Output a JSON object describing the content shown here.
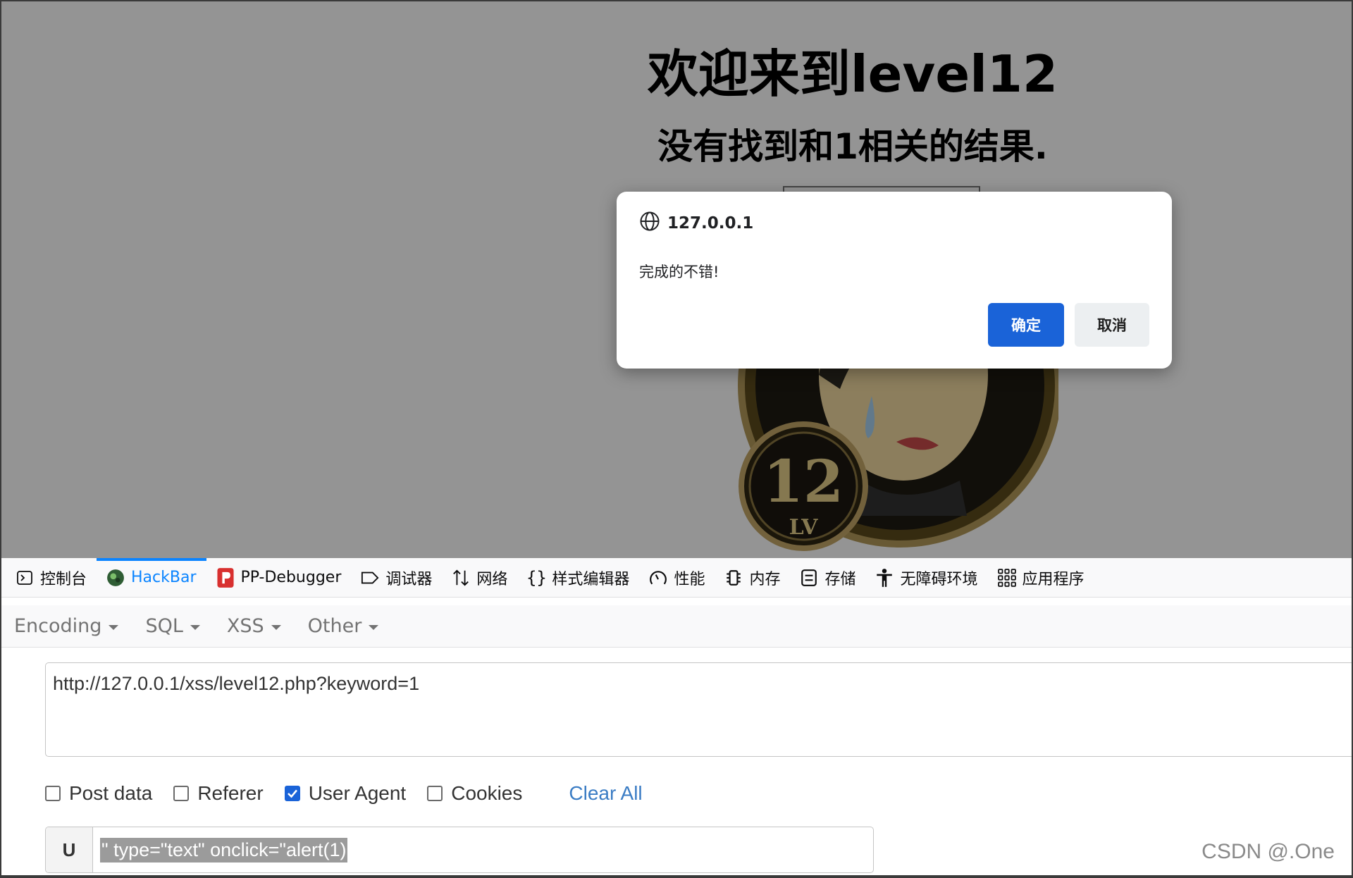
{
  "page": {
    "title": "欢迎来到level12",
    "message": "没有找到和1相关的结果.",
    "badge_number": "12",
    "badge_text": "LV"
  },
  "dialog": {
    "origin": "127.0.0.1",
    "message": "完成的不错!",
    "ok_label": "确定",
    "cancel_label": "取消",
    "ok_color": "#1a63d8"
  },
  "devtools": {
    "tabs": [
      {
        "label": "控制台",
        "icon": "console-icon"
      },
      {
        "label": "HackBar",
        "icon": "hackbar-icon",
        "active": true
      },
      {
        "label": "PP-Debugger",
        "icon": "pp-debugger-icon"
      },
      {
        "label": "调试器",
        "icon": "debugger-icon"
      },
      {
        "label": "网络",
        "icon": "network-icon"
      },
      {
        "label": "样式编辑器",
        "icon": "style-editor-icon"
      },
      {
        "label": "性能",
        "icon": "performance-icon"
      },
      {
        "label": "内存",
        "icon": "memory-icon"
      },
      {
        "label": "存储",
        "icon": "storage-icon"
      },
      {
        "label": "无障碍环境",
        "icon": "accessibility-icon"
      },
      {
        "label": "应用程序",
        "icon": "application-icon"
      }
    ],
    "active_color": "#0a84ff"
  },
  "hackbar": {
    "menus": [
      "Encoding",
      "SQL",
      "XSS",
      "Other"
    ],
    "url": "http://127.0.0.1/xss/level12.php?keyword=1",
    "options": [
      {
        "label": "Post data",
        "checked": false
      },
      {
        "label": "Referer",
        "checked": false
      },
      {
        "label": "User Agent",
        "checked": true
      },
      {
        "label": "Cookies",
        "checked": false
      }
    ],
    "clear_all": "Clear All",
    "ua_label": "U",
    "ua_value": "\" type=\"text\" onclick=\"alert(1)"
  },
  "watermark": "CSDN @.One"
}
